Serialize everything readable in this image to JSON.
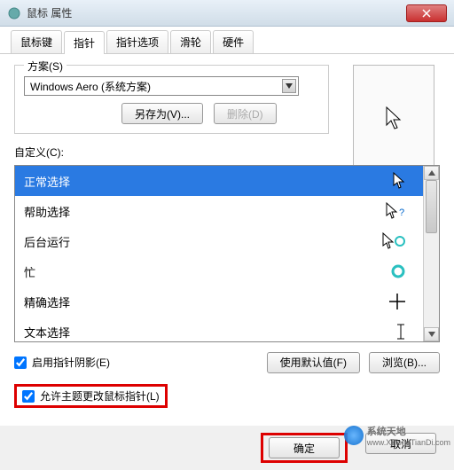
{
  "window": {
    "title": "鼠标 属性"
  },
  "tabs": [
    "鼠标键",
    "指针",
    "指针选项",
    "滑轮",
    "硬件"
  ],
  "active_tab": 1,
  "scheme": {
    "legend": "方案(S)",
    "selected": "Windows Aero (系统方案)",
    "save_as": "另存为(V)...",
    "delete": "删除(D)"
  },
  "custom_label": "自定义(C):",
  "items": [
    {
      "label": "正常选择",
      "glyph": "arrow",
      "selected": true
    },
    {
      "label": "帮助选择",
      "glyph": "arrow-help"
    },
    {
      "label": "后台运行",
      "glyph": "arrow-ring"
    },
    {
      "label": "忙",
      "glyph": "ring"
    },
    {
      "label": "精确选择",
      "glyph": "cross"
    },
    {
      "label": "文本选择",
      "glyph": "ibeam"
    }
  ],
  "shadow_check": "启用指针阴影(E)",
  "theme_check": "允许主题更改鼠标指针(L)",
  "use_default": "使用默认值(F)",
  "browse": "浏览(B)...",
  "ok": "确定",
  "cancel": "取消",
  "watermark": {
    "brand": "系统天地",
    "url": "www.XiTongTianDi.com"
  }
}
